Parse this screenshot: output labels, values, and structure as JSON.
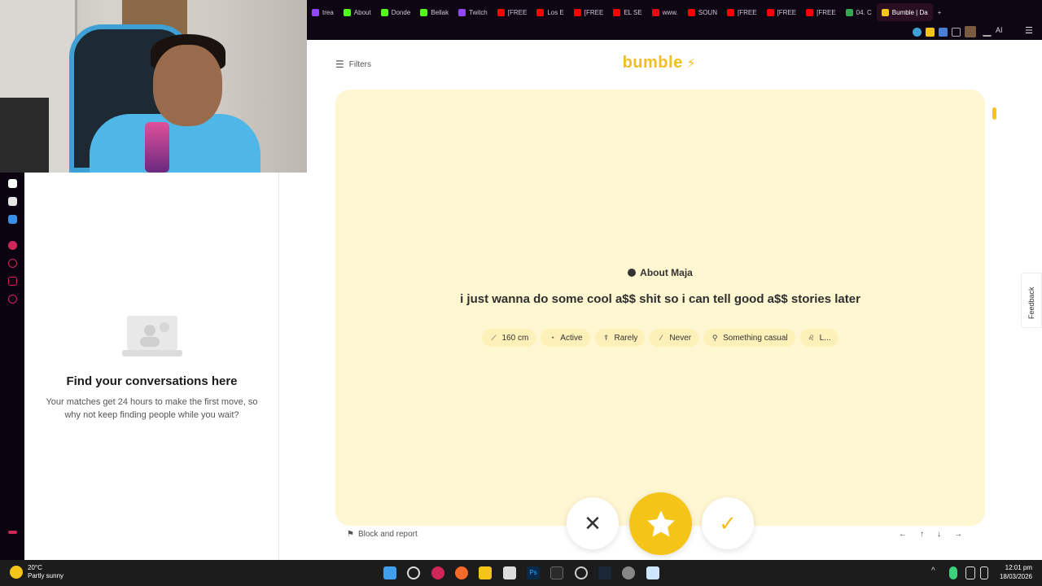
{
  "browser": {
    "tabs": [
      {
        "label": "trea",
        "color": "#9146ff"
      },
      {
        "label": "About",
        "color": "#53fc18"
      },
      {
        "label": "Donde",
        "color": "#53fc18"
      },
      {
        "label": "Bellak",
        "color": "#53fc18"
      },
      {
        "label": "Twitch",
        "color": "#9146ff"
      },
      {
        "label": "[FREE",
        "color": "#ff0000"
      },
      {
        "label": "Los E",
        "color": "#ff0000"
      },
      {
        "label": "[FREE",
        "color": "#ff0000"
      },
      {
        "label": "EL SE",
        "color": "#ff0000"
      },
      {
        "label": "www.",
        "color": "#e50914"
      },
      {
        "label": "SOUN",
        "color": "#ff0000"
      },
      {
        "label": "[FREE",
        "color": "#ff0000"
      },
      {
        "label": "[FREE",
        "color": "#ff0000"
      },
      {
        "label": "[FREE",
        "color": "#ff0000"
      },
      {
        "label": "04. C",
        "color": "#34a853"
      },
      {
        "label": "Bumble | Da",
        "color": "#f5c418",
        "active": true
      }
    ],
    "new_tab_label": "+",
    "toolbar_ai_label": "AI"
  },
  "app": {
    "filters_label": "Filters",
    "logo_text": "bumble",
    "about_header": "About Maja",
    "about_text": "i just wanna do some cool a$$ shit so i can tell good a$$ stories later",
    "chips": [
      {
        "icon": "ruler-icon",
        "glyph": "⟋",
        "label": "160 cm"
      },
      {
        "icon": "exercise-icon",
        "glyph": "◔",
        "label": "Active"
      },
      {
        "icon": "drink-icon",
        "glyph": "⍒",
        "label": "Rarely"
      },
      {
        "icon": "smoking-icon",
        "glyph": "⁄",
        "label": "Never"
      },
      {
        "icon": "search-icon",
        "glyph": "⚲",
        "label": "Something casual"
      },
      {
        "icon": "zodiac-icon",
        "glyph": "♌",
        "label": "L..."
      }
    ],
    "block_report_label": "Block and report",
    "keyboard_hints": [
      "←",
      "↑",
      "↓",
      "→"
    ],
    "feedback_label": "Feedback",
    "colors": {
      "accent": "#f5c418",
      "card_bg": "#fff7d1",
      "chip_bg": "#fdf0b8"
    }
  },
  "conversations": {
    "title": "Find your conversations here",
    "subtitle": "Your matches get 24 hours to make the first move, so why not keep finding people while you wait?"
  },
  "taskbar": {
    "weather_temp": "20°C",
    "weather_desc": "Partly sunny",
    "time": "12:01 pm",
    "date": "18/03/2026"
  }
}
